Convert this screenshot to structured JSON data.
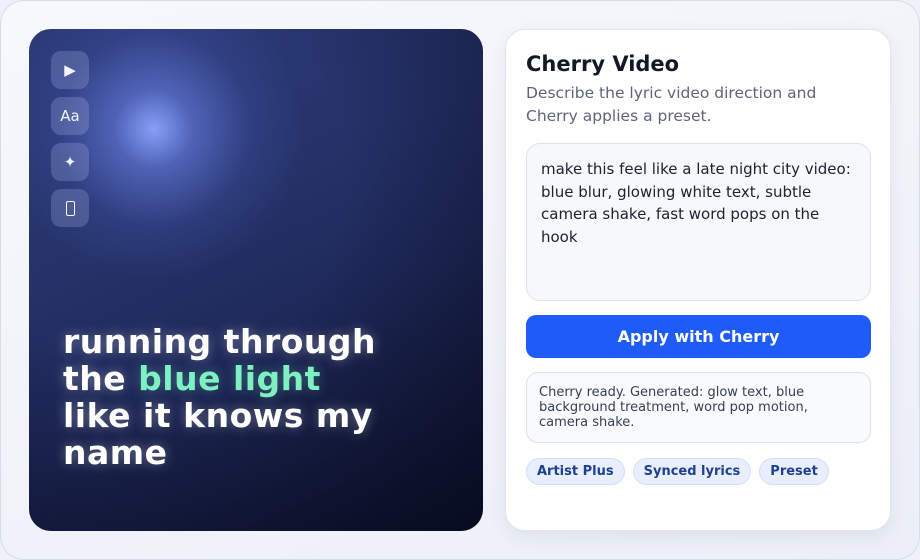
{
  "preview": {
    "toolbar": [
      {
        "icon": "play-icon",
        "glyph": "▶"
      },
      {
        "icon": "text-style-icon",
        "glyph": "Aa"
      },
      {
        "icon": "sparkle-icon",
        "glyph": "✦"
      },
      {
        "icon": "phone-icon",
        "glyph": ""
      }
    ],
    "lyrics": {
      "line1": "running through",
      "line2_prefix": "the ",
      "line2_highlight": "blue light",
      "line3": "like it knows my",
      "line4": "name"
    },
    "colors": {
      "highlight": "#7ef0c2",
      "background": "#26336a"
    }
  },
  "panel": {
    "title": "Cherry Video",
    "description": "Describe the lyric video direction and Cherry applies a preset.",
    "prompt_value": "make this feel like a late night city video: blue blur, glowing white text, subtle camera shake, fast word pops on the hook",
    "apply_label": "Apply with Cherry",
    "status": "Cherry ready. Generated: glow text, blue background treatment, word pop motion, camera shake.",
    "chips": [
      "Artist Plus",
      "Synced lyrics",
      "Preset"
    ],
    "colors": {
      "accent": "#1f5cf7"
    }
  }
}
